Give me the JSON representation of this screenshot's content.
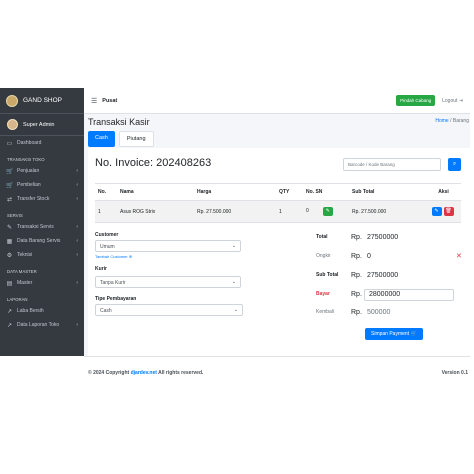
{
  "sidebar": {
    "brand": "GAND SHOP",
    "user": "Super Admin",
    "items": [
      {
        "type": "item",
        "icon": "dashboard-icon",
        "glyph": "▭",
        "label": "Dashboard",
        "chevron": ""
      },
      {
        "type": "header",
        "label": "TRANSAKSI TOKO"
      },
      {
        "type": "item",
        "icon": "cart-icon",
        "glyph": "🛒",
        "label": "Penjualan",
        "chevron": "‹"
      },
      {
        "type": "item",
        "icon": "cart-icon",
        "glyph": "🛒",
        "label": "Pembelian",
        "chevron": "‹"
      },
      {
        "type": "item",
        "icon": "transfer-icon",
        "glyph": "⇄",
        "label": "Transfer Stock",
        "chevron": "‹"
      },
      {
        "type": "header",
        "label": "SERVIS"
      },
      {
        "type": "item",
        "icon": "wrench-icon",
        "glyph": "✎",
        "label": "Transaksi Servis",
        "chevron": "‹"
      },
      {
        "type": "item",
        "icon": "table-icon",
        "glyph": "▦",
        "label": "Data Barang Servis",
        "chevron": "‹"
      },
      {
        "type": "item",
        "icon": "gear-icon",
        "glyph": "⚙",
        "label": "Teknisi",
        "chevron": "‹"
      },
      {
        "type": "header",
        "label": "DATA MASTER"
      },
      {
        "type": "item",
        "icon": "folder-icon",
        "glyph": "▤",
        "label": "Master",
        "chevron": "‹"
      },
      {
        "type": "header",
        "label": "LAPORAN"
      },
      {
        "type": "item",
        "icon": "chart-icon",
        "glyph": "↗",
        "label": "Laba Bersih",
        "chevron": ""
      },
      {
        "type": "item",
        "icon": "chart-icon",
        "glyph": "↗",
        "label": "Data Laporan Toko",
        "chevron": "‹"
      }
    ]
  },
  "topbar": {
    "branch": "Pusat",
    "switch_button": "Pindah Cabang",
    "logout": "Logout"
  },
  "page": {
    "title": "Transaksi Kasir",
    "breadcrumb_home": "Home",
    "breadcrumb_sep": " / ",
    "breadcrumb_current": "Barang"
  },
  "tabs": [
    "Cash",
    "Piutang"
  ],
  "invoice": {
    "label": "No. Invoice: 202408263",
    "barcode_placeholder": "Barcode / Kode Barang"
  },
  "table": {
    "headers": [
      "No.",
      "Nama",
      "Harga",
      "QTY",
      "No. SN",
      "Sub Total",
      "Aksi"
    ],
    "rows": [
      {
        "no": "1",
        "nama": "Asus ROG Strix",
        "harga": "Rp. 27.500.000",
        "qty": "1",
        "sn": "0",
        "subtotal": "Rp. 27.500.000"
      }
    ]
  },
  "form": {
    "customer_label": "Customer",
    "customer_value": "Umum",
    "new_customer_link": "Tambah Customer",
    "courier_label": "Kurir",
    "courier_value": "Tanpa Kurir",
    "payment_label": "Tipe Pembayaran",
    "payment_value": "Cash"
  },
  "summary": {
    "currency": "Rp.",
    "total_label": "Total",
    "total": "27500000",
    "ongkir_label": "Ongkir",
    "ongkir": "0",
    "subtotal_label": "Sub Total",
    "subtotal": "27500000",
    "bayar_label": "Bayar",
    "bayar": "28000000",
    "kembali_label": "Kembali",
    "kembali": "500000",
    "save_button": "Simpan Payment"
  },
  "footer": {
    "copyright_prefix": "© 2024 Copyright ",
    "link": "djardev.net",
    "copyright_suffix": " All rights reserved.",
    "version": "Version 0.1"
  }
}
